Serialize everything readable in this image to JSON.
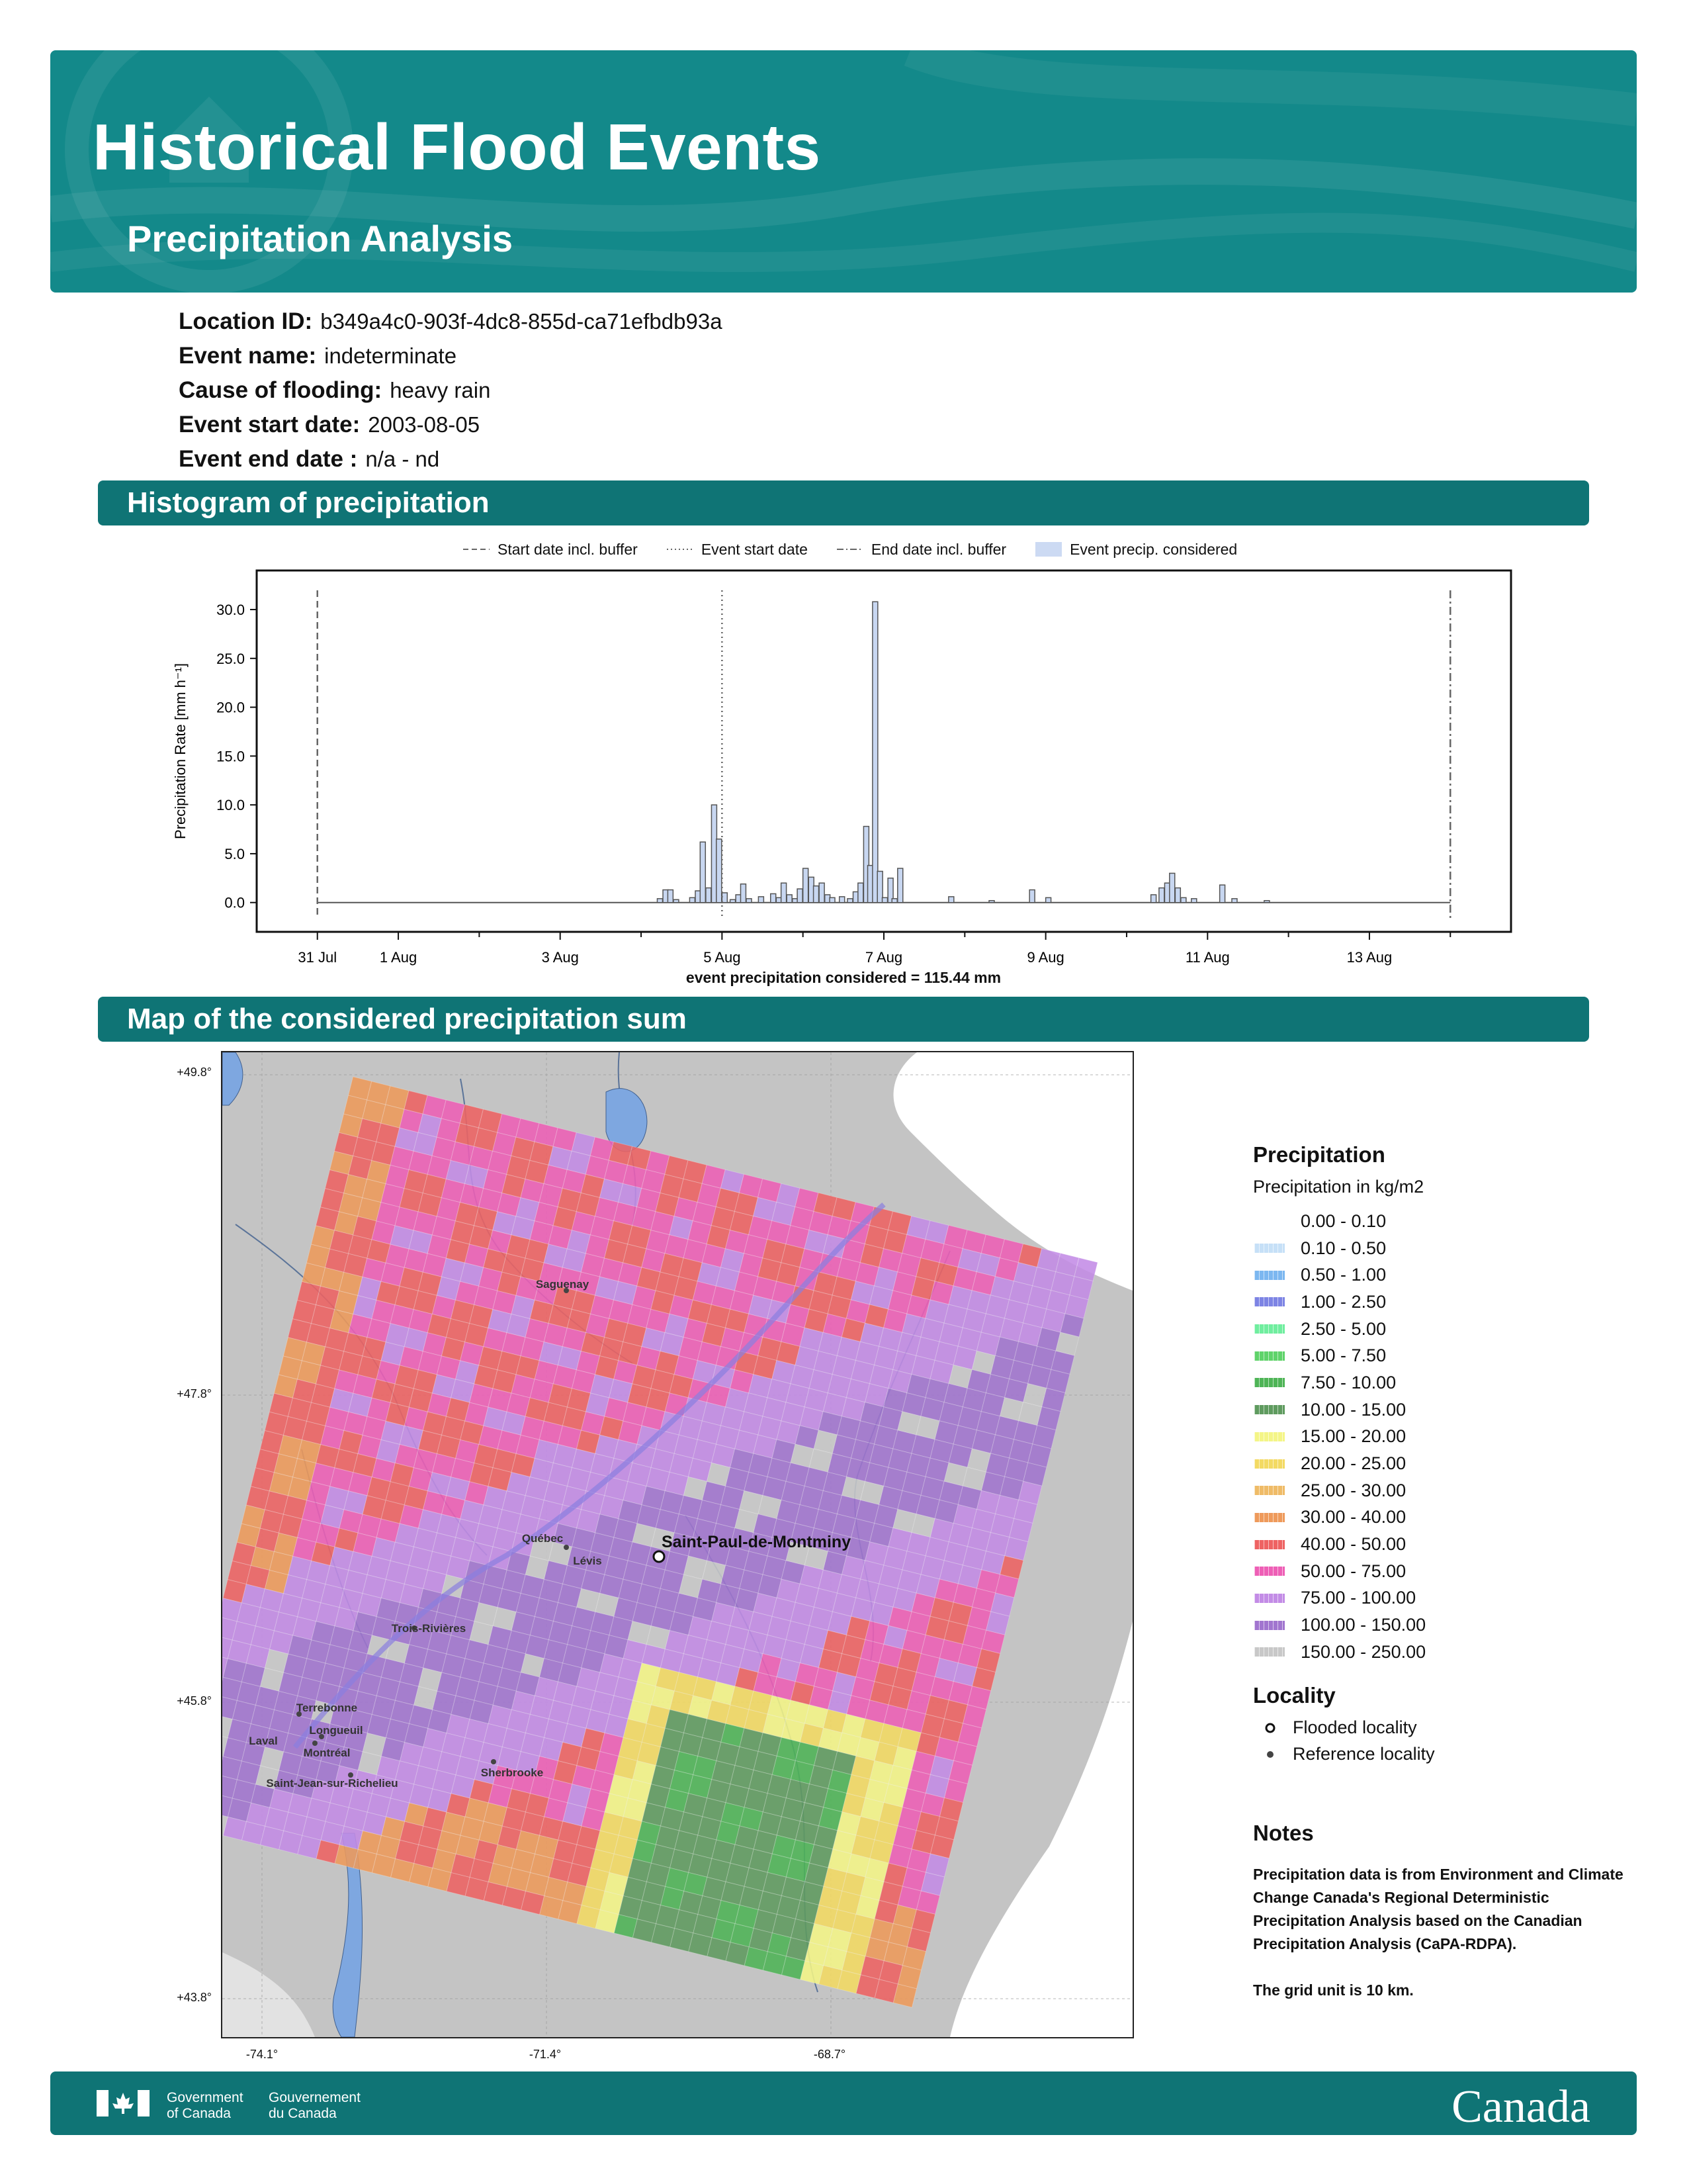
{
  "header": {
    "title": "Historical Flood Events",
    "subtitle": "Precipitation Analysis"
  },
  "info": [
    {
      "label": "Location ID:",
      "value": "b349a4c0-903f-4dc8-855d-ca71efbdb93a"
    },
    {
      "label": "Event name:",
      "value": "indeterminate"
    },
    {
      "label": "Cause of flooding:",
      "value": "heavy rain"
    },
    {
      "label": "Event start date:",
      "value": "2003-08-05"
    },
    {
      "label": "Event end date :",
      "value": "n/a - nd"
    }
  ],
  "sections": {
    "histogram": "Histogram of precipitation",
    "map": "Map of the considered precipitation sum"
  },
  "chart_legend": [
    "Start date incl. buffer",
    "Event start date",
    "End date incl. buffer",
    "Event precip. considered"
  ],
  "chart_data": {
    "type": "bar",
    "title": "",
    "xlabel": "event precipitation considered = 115.44 mm",
    "ylabel": "Precipitation Rate [mm h⁻¹]",
    "x_start": "31 Jul",
    "x_ticks": [
      {
        "day": 0,
        "label": "31 Jul"
      },
      {
        "day": 1,
        "label": "1 Aug"
      },
      {
        "day": 3,
        "label": "3 Aug"
      },
      {
        "day": 5,
        "label": "5 Aug"
      },
      {
        "day": 7,
        "label": "7 Aug"
      },
      {
        "day": 9,
        "label": "9 Aug"
      },
      {
        "day": 11,
        "label": "11 Aug"
      },
      {
        "day": 13,
        "label": "13 Aug"
      }
    ],
    "xlim": [
      -0.75,
      14.75
    ],
    "y_ticks": [
      "0.0",
      "5.0",
      "10.0",
      "15.0",
      "20.0",
      "25.0",
      "30.0"
    ],
    "ylim": [
      -3,
      34
    ],
    "lines": {
      "start_buffer": 0,
      "event_start": 5,
      "end_buffer": 14
    },
    "bars": [
      [
        4.2,
        0.4
      ],
      [
        4.27,
        1.3
      ],
      [
        4.33,
        1.3
      ],
      [
        4.4,
        0.3
      ],
      [
        4.6,
        0.5
      ],
      [
        4.67,
        1.2
      ],
      [
        4.73,
        6.2
      ],
      [
        4.8,
        1.5
      ],
      [
        4.87,
        10.0
      ],
      [
        4.93,
        6.5
      ],
      [
        5.0,
        1.0
      ],
      [
        5.1,
        0.3
      ],
      [
        5.17,
        0.8
      ],
      [
        5.23,
        1.9
      ],
      [
        5.3,
        0.4
      ],
      [
        5.45,
        0.6
      ],
      [
        5.6,
        0.9
      ],
      [
        5.67,
        0.5
      ],
      [
        5.73,
        2.0
      ],
      [
        5.8,
        0.8
      ],
      [
        5.87,
        0.4
      ],
      [
        5.93,
        1.4
      ],
      [
        6.0,
        3.5
      ],
      [
        6.07,
        2.6
      ],
      [
        6.13,
        1.7
      ],
      [
        6.2,
        2.0
      ],
      [
        6.27,
        0.8
      ],
      [
        6.33,
        0.5
      ],
      [
        6.45,
        0.6
      ],
      [
        6.55,
        0.4
      ],
      [
        6.62,
        1.1
      ],
      [
        6.68,
        2.0
      ],
      [
        6.75,
        7.8
      ],
      [
        6.8,
        3.8
      ],
      [
        6.86,
        30.8
      ],
      [
        6.92,
        3.2
      ],
      [
        6.98,
        0.5
      ],
      [
        7.05,
        2.5
      ],
      [
        7.1,
        0.4
      ],
      [
        7.17,
        3.5
      ],
      [
        7.8,
        0.6
      ],
      [
        8.3,
        0.2
      ],
      [
        8.8,
        1.3
      ],
      [
        9.0,
        0.5
      ],
      [
        10.3,
        0.8
      ],
      [
        10.4,
        1.5
      ],
      [
        10.47,
        2.0
      ],
      [
        10.53,
        3.0
      ],
      [
        10.6,
        1.5
      ],
      [
        10.67,
        0.5
      ],
      [
        10.8,
        0.4
      ],
      [
        11.15,
        1.8
      ],
      [
        11.3,
        0.4
      ],
      [
        11.7,
        0.2
      ]
    ]
  },
  "map": {
    "lat_labels": [
      "+49.8°",
      "+47.8°",
      "+45.8°",
      "+43.8°"
    ],
    "lon_labels": [
      "-74.1°",
      "-71.4°",
      "-68.7°"
    ],
    "flooded_locality": "Saint-Paul-de-Montminy",
    "cities": [
      "Saguenay",
      "Québec",
      "Lévis",
      "Trois-Rivières",
      "Sherbrooke",
      "Terrebonne",
      "Longueuil",
      "Laval",
      "Montréal",
      "Saint-Jean-sur-Richelieu"
    ]
  },
  "precip_legend": {
    "title": "Precipitation",
    "subtitle": "Precipitation in kg/m2",
    "items": [
      {
        "label": "0.00 - 0.10",
        "color": "#ffffff"
      },
      {
        "label": "0.10 - 0.50",
        "color": "#c6e0f7"
      },
      {
        "label": "0.50 - 1.00",
        "color": "#7cb7f0"
      },
      {
        "label": "1.00 - 2.50",
        "color": "#7d84e4"
      },
      {
        "label": "2.50 - 5.00",
        "color": "#70ee9f"
      },
      {
        "label": "5.00 - 7.50",
        "color": "#5fd36a"
      },
      {
        "label": "7.50 - 10.00",
        "color": "#4eb456"
      },
      {
        "label": "10.00 - 15.00",
        "color": "#5f9b5f"
      },
      {
        "label": "15.00 - 20.00",
        "color": "#f4f587"
      },
      {
        "label": "20.00 - 25.00",
        "color": "#f3da63"
      },
      {
        "label": "25.00 - 30.00",
        "color": "#efbb67"
      },
      {
        "label": "30.00 - 40.00",
        "color": "#ee9a5b"
      },
      {
        "label": "40.00 - 50.00",
        "color": "#ee6363"
      },
      {
        "label": "50.00 - 75.00",
        "color": "#ee5fb6"
      },
      {
        "label": "75.00 - 100.00",
        "color": "#c38ce6"
      },
      {
        "label": "100.00 - 150.00",
        "color": "#a175cf"
      },
      {
        "label": "150.00 - 250.00",
        "color": "#c8c8c8"
      }
    ]
  },
  "locality_legend": {
    "title": "Locality",
    "flooded": "Flooded locality",
    "reference": "Reference locality"
  },
  "notes": {
    "title": "Notes",
    "text": "Precipitation data is from Environment and Climate Change Canada's Regional Deterministic Precipitation Analysis based on the Canadian Precipitation Analysis (CaPA-RDPA).",
    "grid": "The grid unit is 10 km."
  },
  "footer": {
    "gov_en": [
      "Government",
      "of Canada"
    ],
    "gov_fr": [
      "Gouvernement",
      "du Canada"
    ],
    "wordmark": "Canada"
  }
}
